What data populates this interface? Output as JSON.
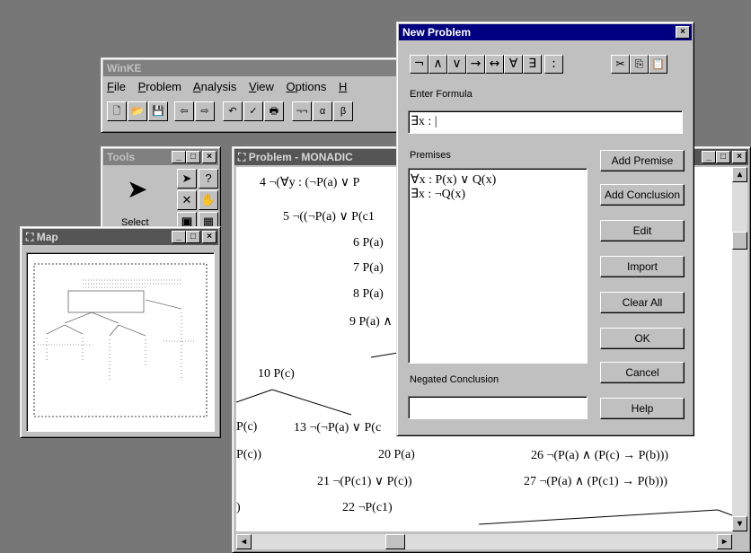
{
  "winke": {
    "title": "WinKE",
    "menu": [
      {
        "first": "F",
        "rest": "ile"
      },
      {
        "first": "P",
        "rest": "roblem"
      },
      {
        "first": "A",
        "rest": "nalysis"
      },
      {
        "first": "V",
        "rest": "iew"
      },
      {
        "first": "O",
        "rest": "ptions"
      },
      {
        "first": "H",
        "rest": ""
      }
    ],
    "toolbar_icons": [
      "new-file-icon",
      "open-folder-icon",
      "save-icon",
      "back-arrow-icon",
      "forward-arrow-icon",
      "undo-icon",
      "check-icon",
      "print-icon",
      "double-negation-icon",
      "alpha-icon",
      "beta-icon"
    ],
    "toolbar_glyphs": [
      "🗋",
      "📂",
      "💾",
      "⇦",
      "⇨",
      "↶",
      "✓",
      "🖶",
      "¬¬",
      "α",
      "β"
    ]
  },
  "tools": {
    "title": "Tools",
    "select_label": "Select",
    "icons": [
      "select-arrow-icon",
      "help-cursor-icon",
      "delete-x-icon",
      "hand-icon",
      "binoculars-icon",
      "grid-icon"
    ],
    "glyphs": [
      "➤",
      "?",
      "✕",
      "✋",
      "👓",
      "▦"
    ]
  },
  "map": {
    "title": "Map"
  },
  "problem": {
    "title": "Problem - MONADIC",
    "lines": [
      "4 ¬(∀y : (¬P(a) ∨ P",
      "5 ¬((¬P(a) ∨ P(c1",
      "6 P(a)",
      "7 P(a)",
      "8 P(a)",
      "9 P(a) ∧",
      "10 P(c)",
      "P(c)",
      "13 ¬(¬P(a) ∨ P(c",
      "P(c))",
      "20 P(a)",
      "26 ¬(P(a) ∧ (P(c) → P(b)))",
      "21 ¬(P(c1) ∨ P(c))",
      "27 ¬(P(a) ∧ (P(c1) → P(b)))",
      ")",
      "22 ¬P(c1)"
    ]
  },
  "dialog": {
    "title": "New Problem",
    "symbols": [
      "¬",
      "∧",
      "∨",
      "→",
      "↔",
      "∀",
      "∃",
      ":"
    ],
    "clipboard_icons": [
      "cut-icon",
      "copy-icon",
      "paste-icon"
    ],
    "clipboard_glyphs": [
      "✂",
      "⎘",
      "📋"
    ],
    "enter_formula_label": "Enter Formula",
    "formula_value": "∃x : |",
    "premises_label": "Premises",
    "premises": [
      "∀x : P(x) ∨ Q(x)",
      "∃x : ¬Q(x)"
    ],
    "negated_conclusion_label": "Negated Conclusion",
    "negated_conclusion_value": "",
    "buttons": {
      "add_premise": "Add Premise",
      "add_conclusion": "Add Conclusion",
      "edit": "Edit",
      "import": "Import",
      "clear_all": "Clear All",
      "ok": "OK",
      "cancel": "Cancel",
      "help": "Help"
    },
    "close_glyph": "×"
  }
}
